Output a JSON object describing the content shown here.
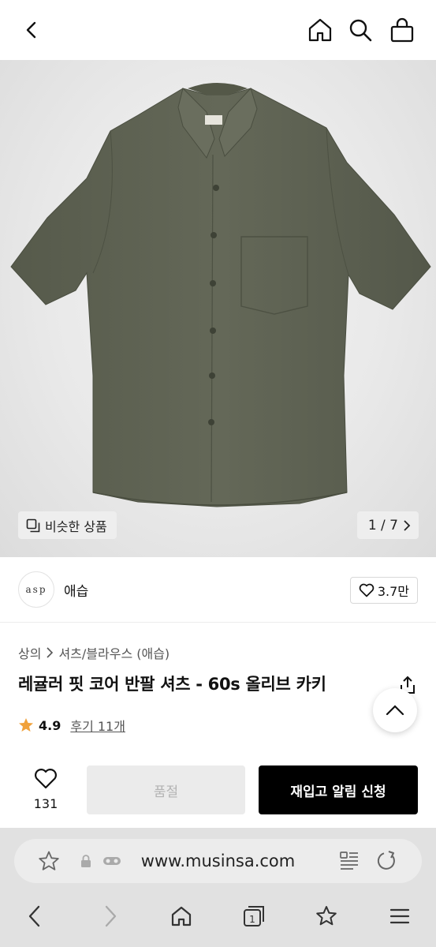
{
  "header": {
    "back_icon": "chevron-left-icon",
    "home_icon": "home-icon",
    "search_icon": "search-icon",
    "cart_icon": "shopping-bag-icon"
  },
  "gallery": {
    "similar_label": "비슷한 상품",
    "counter": "1 / 7",
    "shirt_color": "#5f6353"
  },
  "brand": {
    "logo_text": "asp",
    "name": "애습",
    "likes": "3.7만"
  },
  "product": {
    "breadcrumb": [
      "상의",
      "셔츠/블라우스 (애습)"
    ],
    "title": "레귤러 핏 코어 반팔 셔츠 - 60s 올리브 카키",
    "rating": "4.9",
    "reviews": "후기 11개"
  },
  "actions": {
    "wish_count": "131",
    "soldout_label": "품절",
    "restock_label": "재입고 알림 신청"
  },
  "browser": {
    "url": "www.musinsa.com"
  },
  "colors": {
    "accent_black": "#000000",
    "star": "#f0a13a"
  }
}
